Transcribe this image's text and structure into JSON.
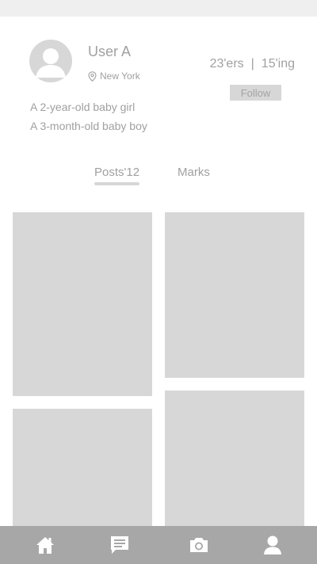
{
  "profile": {
    "username": "User A",
    "location": "New York",
    "followers": "23'ers",
    "separator": "|",
    "following": "15'ing",
    "follow_label": "Follow",
    "bio": [
      "A 2-year-old baby girl",
      "A 3-month-old baby boy"
    ]
  },
  "tabs": {
    "posts_label": "Posts'12",
    "marks_label": "Marks"
  },
  "bottom_nav": {
    "icons": [
      "home-icon",
      "messages-icon",
      "camera-icon",
      "profile-icon"
    ]
  },
  "colors": {
    "placeholder": "#d7d7d7",
    "nav_bar": "#a7a7a7",
    "text": "#a0a0a0",
    "status_bar": "#efefef"
  }
}
